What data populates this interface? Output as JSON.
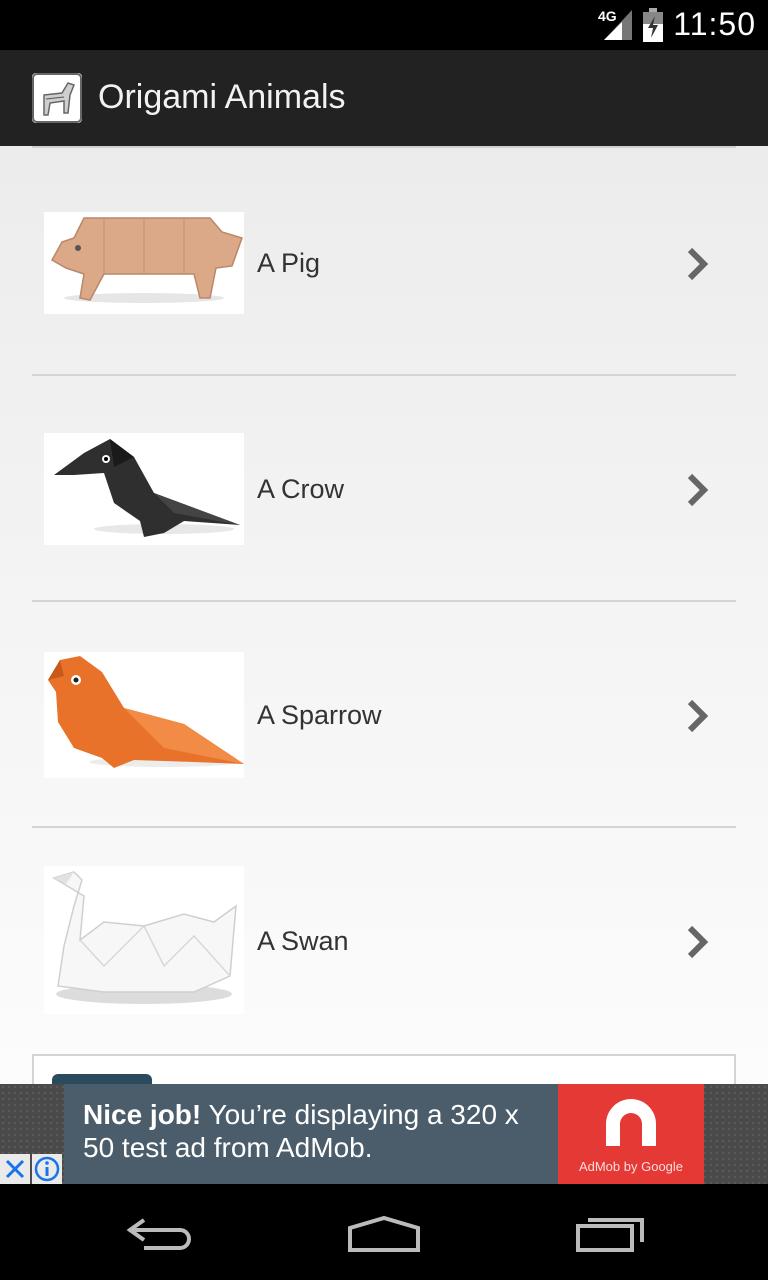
{
  "status_bar": {
    "network": "4G",
    "time": "11:50"
  },
  "app": {
    "title": "Origami Animals"
  },
  "items": [
    {
      "label": "A Pig"
    },
    {
      "label": "A Crow"
    },
    {
      "label": "A Sparrow"
    },
    {
      "label": "A Swan"
    }
  ],
  "ad": {
    "headline": "Nice job!",
    "body": " You’re displaying a 320 x 50 test ad from AdMob.",
    "brand": "AdMob by Google"
  },
  "colors": {
    "action_bar": "#222222",
    "ad_background": "#4b5d6a",
    "ad_logo": "#e53935",
    "close_x": "#1a73e8"
  }
}
